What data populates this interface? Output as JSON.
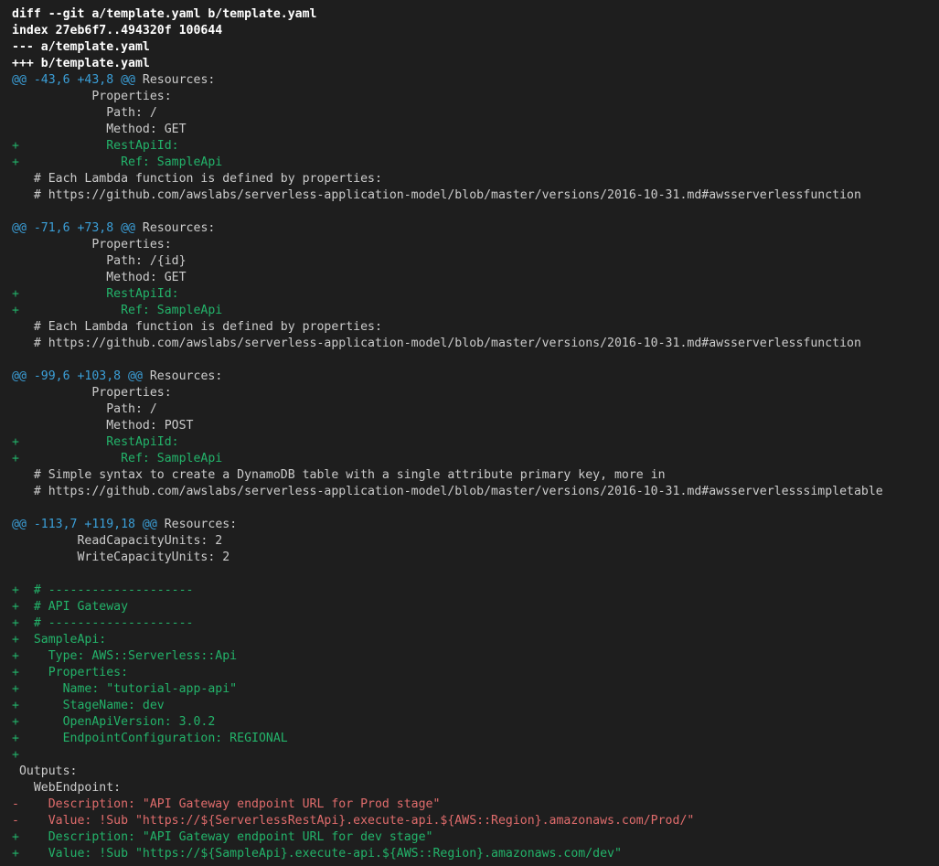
{
  "colors": {
    "background": "#1e1e1e",
    "meta": "#ffffff",
    "context": "#cccccc",
    "hunk_range": "#3b9fd8",
    "added": "#23b36a",
    "removed": "#e06c6c"
  },
  "diff": {
    "lines": [
      {
        "kind": "meta",
        "text": "diff --git a/template.yaml b/template.yaml"
      },
      {
        "kind": "meta",
        "text": "index 27eb6f7..494320f 100644"
      },
      {
        "kind": "meta",
        "text": "--- a/template.yaml"
      },
      {
        "kind": "meta",
        "text": "+++ b/template.yaml"
      },
      {
        "kind": "hunk",
        "range": "@@ -43,6 +43,8 @@",
        "text": " Resources:"
      },
      {
        "kind": "ctx",
        "text": "           Properties:"
      },
      {
        "kind": "ctx",
        "text": "             Path: /"
      },
      {
        "kind": "ctx",
        "text": "             Method: GET"
      },
      {
        "kind": "add",
        "text": "+            RestApiId:"
      },
      {
        "kind": "add",
        "text": "+              Ref: SampleApi"
      },
      {
        "kind": "ctx",
        "text": "   # Each Lambda function is defined by properties:"
      },
      {
        "kind": "ctx",
        "text": "   # https://github.com/awslabs/serverless-application-model/blob/master/versions/2016-10-31.md#awsserverlessfunction"
      },
      {
        "kind": "blank",
        "text": ""
      },
      {
        "kind": "hunk",
        "range": "@@ -71,6 +73,8 @@",
        "text": " Resources:"
      },
      {
        "kind": "ctx",
        "text": "           Properties:"
      },
      {
        "kind": "ctx",
        "text": "             Path: /{id}"
      },
      {
        "kind": "ctx",
        "text": "             Method: GET"
      },
      {
        "kind": "add",
        "text": "+            RestApiId:"
      },
      {
        "kind": "add",
        "text": "+              Ref: SampleApi"
      },
      {
        "kind": "ctx",
        "text": "   # Each Lambda function is defined by properties:"
      },
      {
        "kind": "ctx",
        "text": "   # https://github.com/awslabs/serverless-application-model/blob/master/versions/2016-10-31.md#awsserverlessfunction"
      },
      {
        "kind": "blank",
        "text": ""
      },
      {
        "kind": "hunk",
        "range": "@@ -99,6 +103,8 @@",
        "text": " Resources:"
      },
      {
        "kind": "ctx",
        "text": "           Properties:"
      },
      {
        "kind": "ctx",
        "text": "             Path: /"
      },
      {
        "kind": "ctx",
        "text": "             Method: POST"
      },
      {
        "kind": "add",
        "text": "+            RestApiId:"
      },
      {
        "kind": "add",
        "text": "+              Ref: SampleApi"
      },
      {
        "kind": "ctx",
        "text": "   # Simple syntax to create a DynamoDB table with a single attribute primary key, more in"
      },
      {
        "kind": "ctx",
        "text": "   # https://github.com/awslabs/serverless-application-model/blob/master/versions/2016-10-31.md#awsserverlesssimpletable"
      },
      {
        "kind": "blank",
        "text": ""
      },
      {
        "kind": "hunk",
        "range": "@@ -113,7 +119,18 @@",
        "text": " Resources:"
      },
      {
        "kind": "ctx",
        "text": "         ReadCapacityUnits: 2"
      },
      {
        "kind": "ctx",
        "text": "         WriteCapacityUnits: 2"
      },
      {
        "kind": "blank",
        "text": ""
      },
      {
        "kind": "add",
        "text": "+  # --------------------"
      },
      {
        "kind": "add",
        "text": "+  # API Gateway"
      },
      {
        "kind": "add",
        "text": "+  # --------------------"
      },
      {
        "kind": "add",
        "text": "+  SampleApi:"
      },
      {
        "kind": "add",
        "text": "+    Type: AWS::Serverless::Api"
      },
      {
        "kind": "add",
        "text": "+    Properties:"
      },
      {
        "kind": "add",
        "text": "+      Name: \"tutorial-app-api\""
      },
      {
        "kind": "add",
        "text": "+      StageName: dev"
      },
      {
        "kind": "add",
        "text": "+      OpenApiVersion: 3.0.2"
      },
      {
        "kind": "add",
        "text": "+      EndpointConfiguration: REGIONAL"
      },
      {
        "kind": "add",
        "text": "+"
      },
      {
        "kind": "ctx",
        "text": " Outputs:"
      },
      {
        "kind": "ctx",
        "text": "   WebEndpoint:"
      },
      {
        "kind": "del",
        "text": "-    Description: \"API Gateway endpoint URL for Prod stage\""
      },
      {
        "kind": "del",
        "text": "-    Value: !Sub \"https://${ServerlessRestApi}.execute-api.${AWS::Region}.amazonaws.com/Prod/\""
      },
      {
        "kind": "add",
        "text": "+    Description: \"API Gateway endpoint URL for dev stage\""
      },
      {
        "kind": "add",
        "text": "+    Value: !Sub \"https://${SampleApi}.execute-api.${AWS::Region}.amazonaws.com/dev\""
      }
    ]
  }
}
